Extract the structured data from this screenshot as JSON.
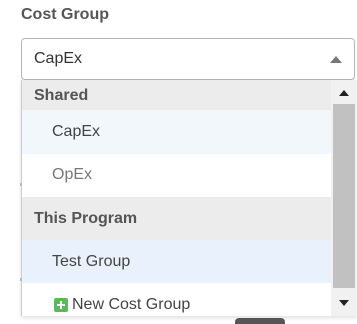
{
  "field": {
    "label": "Cost Group",
    "selected_value": "CapEx"
  },
  "dropdown": {
    "groups": [
      {
        "header": "Shared",
        "options": [
          "CapEx",
          "OpEx"
        ]
      },
      {
        "header": "This Program",
        "options": [
          "Test Group"
        ]
      }
    ],
    "new_item_label": "New Cost Group",
    "new_item_icon": "plus-square-icon"
  },
  "colors": {
    "accent_green": "#5cb85c",
    "selected_bg": "#f2f7fc",
    "group_header_bg": "#ececec"
  }
}
